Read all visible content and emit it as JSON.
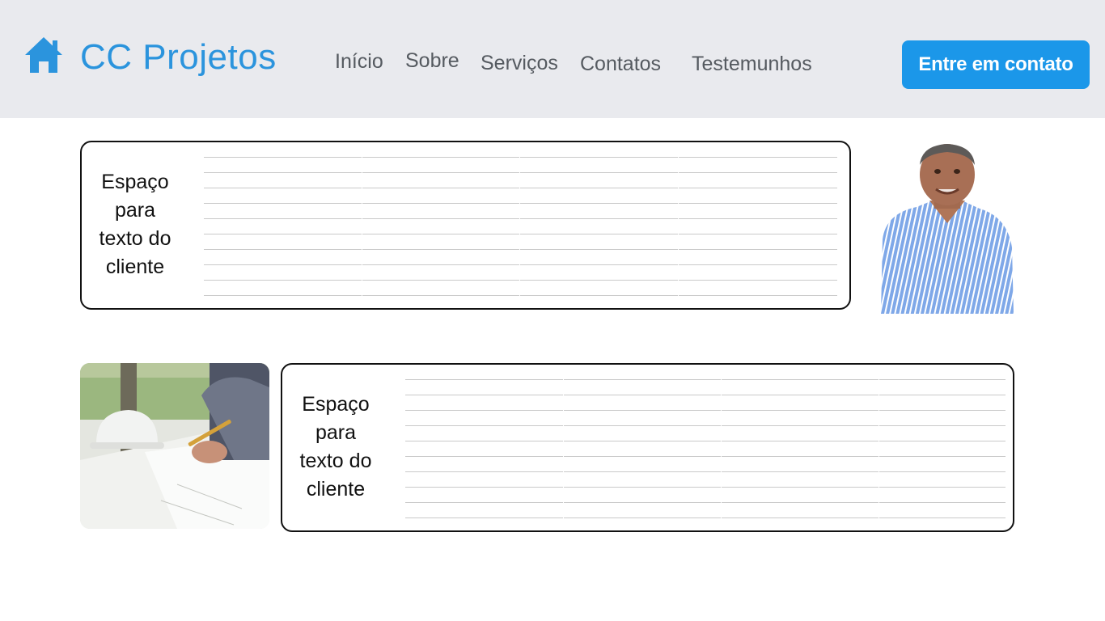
{
  "header": {
    "brand": "CC Projetos",
    "logo_icon": "home-icon",
    "nav": [
      "Início",
      "Sobre",
      "Serviços",
      "Contatos",
      "Testemunhos"
    ],
    "cta_label": "Entre em contato"
  },
  "testimonials": [
    {
      "text_lines": [
        "Espaço",
        "para",
        "texto do",
        "cliente"
      ],
      "image": "client-portrait"
    },
    {
      "text_lines": [
        "Espaço",
        "para",
        "texto do",
        "cliente"
      ],
      "image": "architect-blueprint-photo"
    }
  ],
  "colors": {
    "header_bg": "#e9eaee",
    "brand": "#2b94dd",
    "cta_bg": "#1b97e9",
    "nav_text": "#555a60"
  }
}
